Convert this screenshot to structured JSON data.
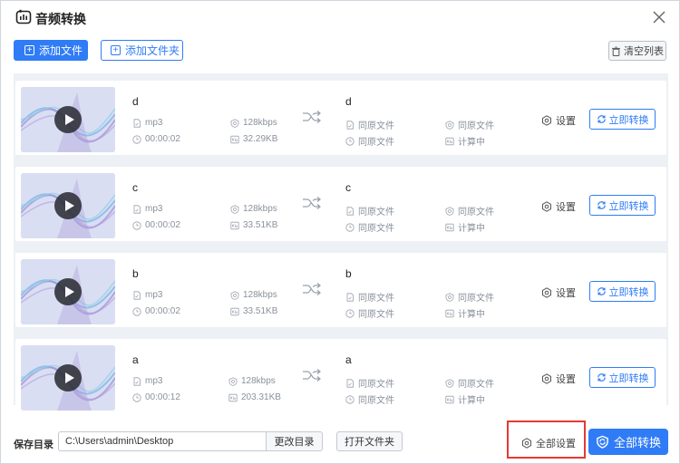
{
  "window": {
    "title": "音频转换",
    "close_icon": "close-icon"
  },
  "toolbar": {
    "add_file": "添加文件",
    "add_folder": "添加文件夹",
    "clear_list": "清空列表"
  },
  "rows": [
    {
      "name": "d",
      "source": {
        "format": "mp3",
        "bitrate": "128kbps",
        "duration": "00:00:02",
        "size": "32.29KB"
      },
      "target": {
        "name": "d",
        "format": "同原文件",
        "bitrate": "同原文件",
        "duration": "同原文件",
        "size": "计算中"
      },
      "settings": "设置",
      "convert": "立即转换"
    },
    {
      "name": "c",
      "source": {
        "format": "mp3",
        "bitrate": "128kbps",
        "duration": "00:00:02",
        "size": "33.51KB"
      },
      "target": {
        "name": "c",
        "format": "同原文件",
        "bitrate": "同原文件",
        "duration": "同原文件",
        "size": "计算中"
      },
      "settings": "设置",
      "convert": "立即转换"
    },
    {
      "name": "b",
      "source": {
        "format": "mp3",
        "bitrate": "128kbps",
        "duration": "00:00:02",
        "size": "33.51KB"
      },
      "target": {
        "name": "b",
        "format": "同原文件",
        "bitrate": "同原文件",
        "duration": "同原文件",
        "size": "计算中"
      },
      "settings": "设置",
      "convert": "立即转换"
    },
    {
      "name": "a",
      "source": {
        "format": "mp3",
        "bitrate": "128kbps",
        "duration": "00:00:12",
        "size": "203.31KB"
      },
      "target": {
        "name": "a",
        "format": "同原文件",
        "bitrate": "同原文件",
        "duration": "同原文件",
        "size": "计算中"
      },
      "settings": "设置",
      "convert": "立即转换"
    }
  ],
  "footer": {
    "save_label": "保存目录",
    "path": "C:\\Users\\admin\\Desktop",
    "change_dir": "更改目录",
    "open_folder": "打开文件夹",
    "all_settings": "全部设置",
    "convert_all": "全部转换"
  },
  "colors": {
    "accent": "#2f7cf6",
    "highlight": "#e53935",
    "list_bg": "#edf0f4"
  }
}
